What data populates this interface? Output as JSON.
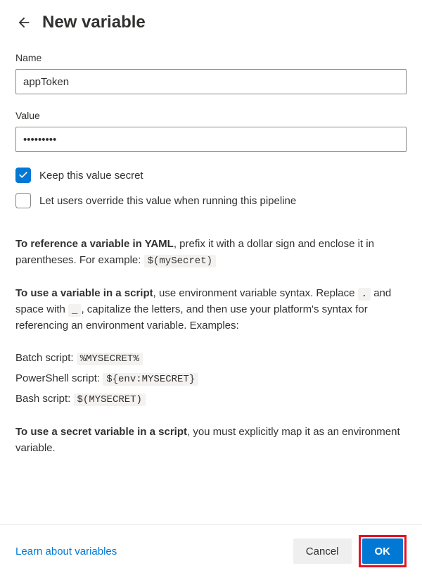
{
  "header": {
    "title": "New variable"
  },
  "form": {
    "name_label": "Name",
    "name_value": "appToken",
    "value_label": "Value",
    "value_value": "•••••••••",
    "keep_secret_label": "Keep this value secret",
    "keep_secret_checked": true,
    "allow_override_label": "Let users override this value when running this pipeline",
    "allow_override_checked": false
  },
  "help": {
    "yaml": {
      "lead_bold": "To reference a variable in YAML",
      "lead_rest": ", prefix it with a dollar sign and enclose it in parentheses. For example: ",
      "example": "$(mySecret)"
    },
    "script": {
      "lead_bold": "To use a variable in a script",
      "seg1": ", use environment variable syntax. Replace ",
      "code1": ".",
      "seg2": " and space with ",
      "code2": "_",
      "seg3": ", capitalize the letters, and then use your platform's syntax for referencing an environment variable. Examples:"
    },
    "examples": {
      "batch_label": "Batch script: ",
      "batch_code": "%MYSECRET%",
      "ps_label": "PowerShell script: ",
      "ps_code": "${env:MYSECRET}",
      "bash_label": "Bash script: ",
      "bash_code": "$(MYSECRET)"
    },
    "secret": {
      "lead_bold": "To use a secret variable in a script",
      "lead_rest": ", you must explicitly map it as an environment variable."
    }
  },
  "footer": {
    "learn_link": "Learn about variables",
    "cancel": "Cancel",
    "ok": "OK"
  }
}
